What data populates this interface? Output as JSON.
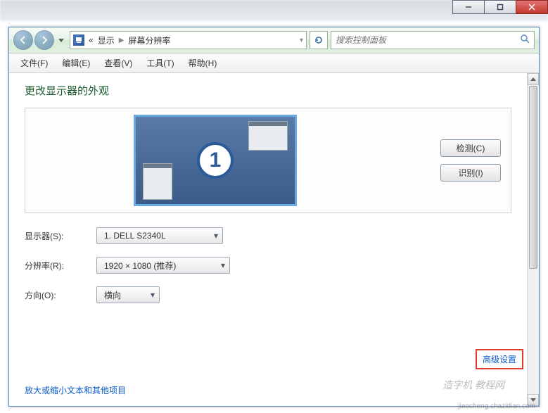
{
  "window": {
    "minimize": "–",
    "maximize": "▢",
    "close": "×"
  },
  "address": {
    "seg1": "显示",
    "seg2": "屏幕分辨率"
  },
  "search": {
    "placeholder": "搜索控制面板"
  },
  "menu": {
    "file": "文件(F)",
    "edit": "编辑(E)",
    "view": "查看(V)",
    "tools": "工具(T)",
    "help": "帮助(H)"
  },
  "content": {
    "heading": "更改显示器的外观",
    "monitor_num": "1",
    "btn_detect": "检测(C)",
    "btn_identify": "识别(I)",
    "label_display": "显示器(S):",
    "value_display": "1. DELL S2340L",
    "label_resolution": "分辨率(R):",
    "value_resolution": "1920 × 1080 (推荐)",
    "label_orientation": "方向(O):",
    "value_orientation": "横向",
    "advanced_link": "高级设置",
    "zoom_link": "放大或缩小文本和其他项目"
  },
  "watermark": {
    "main": "造字机 教程网",
    "sub": "jiaocheng.chazidian.com"
  }
}
